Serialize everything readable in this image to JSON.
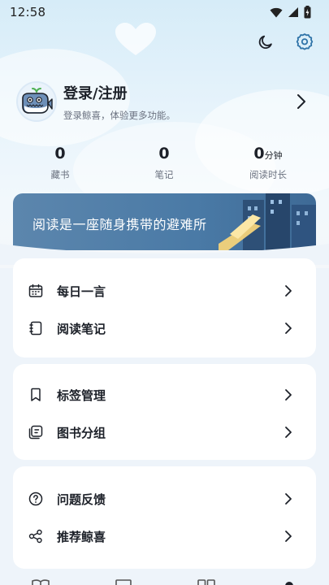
{
  "status_bar": {
    "time": "12:58",
    "icons": [
      "wifi-icon",
      "cellular-signal-icon",
      "battery-icon"
    ]
  },
  "top_actions": [
    "moon-icon",
    "gear-icon"
  ],
  "profile": {
    "title": "登录/注册",
    "subtitle": "登录鲸喜，体验更多功能。",
    "avatar_icon": "whale-icon"
  },
  "stats": [
    {
      "value": "0",
      "unit": "",
      "label": "藏书"
    },
    {
      "value": "0",
      "unit": "",
      "label": "笔记"
    },
    {
      "value": "0",
      "unit": "分钟",
      "label": "阅读时长"
    }
  ],
  "banner": {
    "text": "阅读是一座随身携带的避难所"
  },
  "menu_groups": [
    {
      "items": [
        {
          "label": "每日一言",
          "icon": "calendar-icon"
        },
        {
          "label": "阅读笔记",
          "icon": "notebook-icon"
        }
      ]
    },
    {
      "items": [
        {
          "label": "标签管理",
          "icon": "bookmark-icon"
        },
        {
          "label": "图书分组",
          "icon": "group-icon"
        }
      ]
    },
    {
      "items": [
        {
          "label": "问题反馈",
          "icon": "question-icon"
        },
        {
          "label": "推荐鲸喜",
          "icon": "share-icon"
        }
      ]
    }
  ],
  "bottom_nav": [
    "bookshelf-tab-icon",
    "notes-tab-icon",
    "discover-tab-icon",
    "profile-tab-icon"
  ],
  "colors": {
    "accent": "#2f73a8",
    "banner": "#4a7aa6",
    "text_primary": "#1d2129",
    "text_secondary": "#6b7280"
  }
}
